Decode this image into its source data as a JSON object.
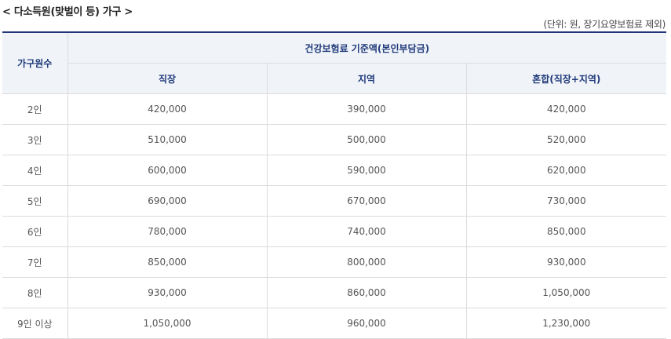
{
  "heading": "< 다소득원(맞벌이 등) 가구 >",
  "unit_note": "(단위: 원, 장기요양보험료 제외)",
  "table": {
    "row_header": "가구원수",
    "group_header": "건강보험료 기준액(본인부담금)",
    "columns": [
      "직장",
      "지역",
      "혼합(직장+지역)"
    ],
    "rows": [
      {
        "label": "2인",
        "values": [
          "420,000",
          "390,000",
          "420,000"
        ]
      },
      {
        "label": "3인",
        "values": [
          "510,000",
          "500,000",
          "520,000"
        ]
      },
      {
        "label": "4인",
        "values": [
          "600,000",
          "590,000",
          "620,000"
        ]
      },
      {
        "label": "5인",
        "values": [
          "690,000",
          "670,000",
          "730,000"
        ]
      },
      {
        "label": "6인",
        "values": [
          "780,000",
          "740,000",
          "850,000"
        ]
      },
      {
        "label": "7인",
        "values": [
          "850,000",
          "800,000",
          "930,000"
        ]
      },
      {
        "label": "8인",
        "values": [
          "930,000",
          "860,000",
          "1,050,000"
        ]
      },
      {
        "label": "9인 이상",
        "values": [
          "1,050,000",
          "960,000",
          "1,230,000"
        ]
      }
    ]
  }
}
